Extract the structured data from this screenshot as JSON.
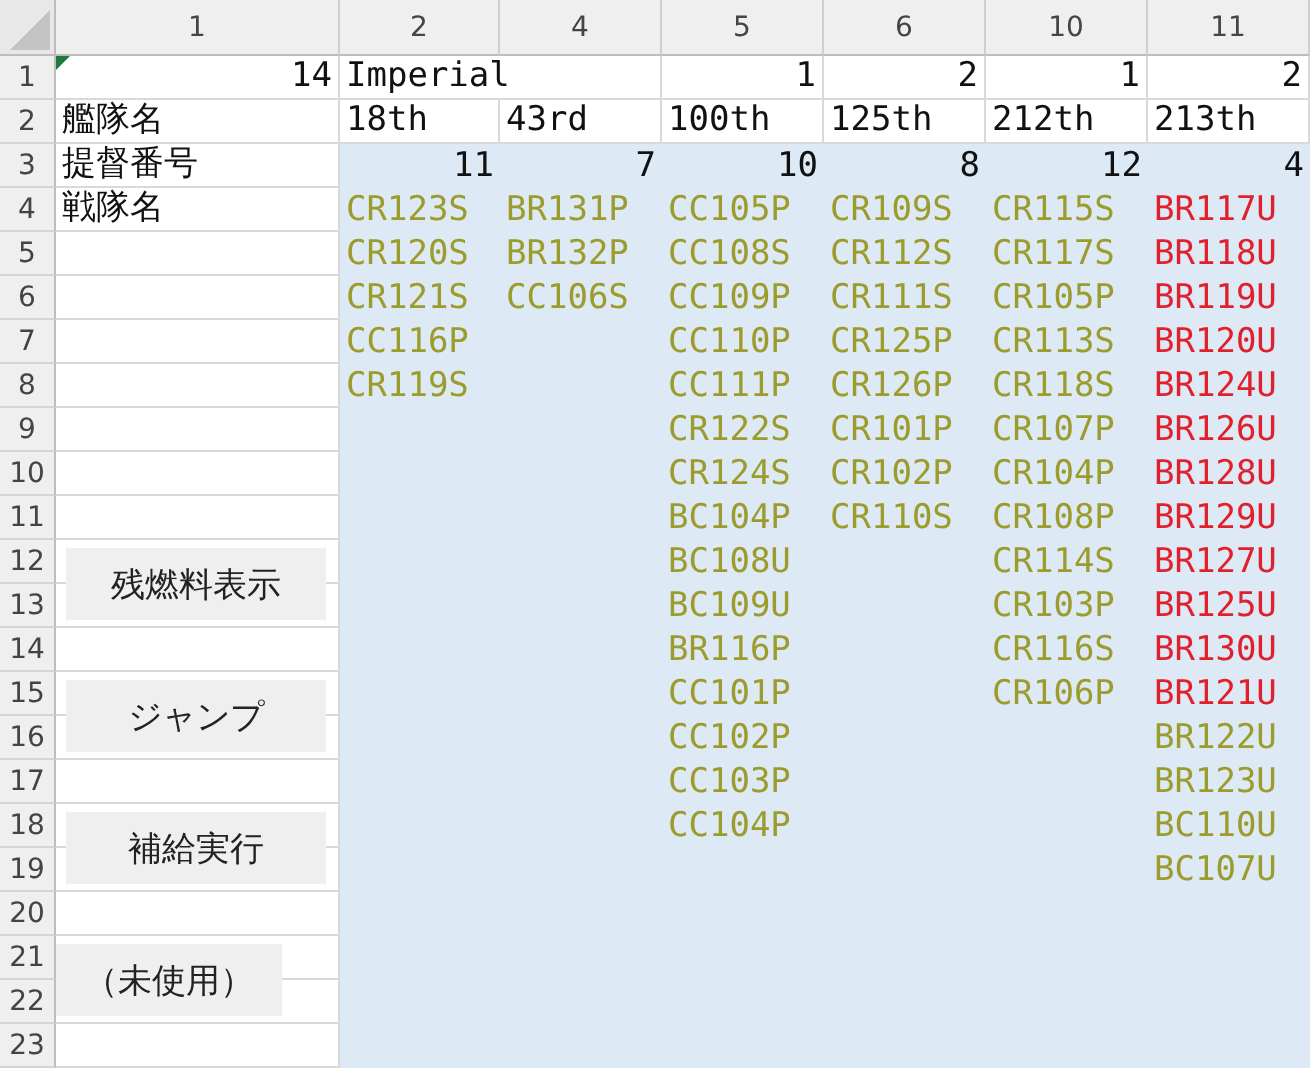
{
  "column_headers": [
    "1",
    "2",
    "4",
    "5",
    "6",
    "10",
    "11"
  ],
  "row_headers": [
    "1",
    "2",
    "3",
    "4",
    "5",
    "6",
    "7",
    "8",
    "9",
    "10",
    "11",
    "12",
    "13",
    "14",
    "15",
    "16",
    "17",
    "18",
    "19",
    "20",
    "21",
    "22",
    "23"
  ],
  "total": "14",
  "faction": "Imperial",
  "labels": [
    "艦隊名",
    "提督番号",
    "戦隊名"
  ],
  "fleets": [
    {
      "name": "18th",
      "admiral": "11",
      "units": [
        {
          "code": "CR123S",
          "color": "#9c9c2c"
        },
        {
          "code": "CR120S",
          "color": "#9c9c2c"
        },
        {
          "code": "CR121S",
          "color": "#9c9c2c"
        },
        {
          "code": "CC116P",
          "color": "#9c9c2c"
        },
        {
          "code": "CR119S",
          "color": "#9c9c2c"
        }
      ]
    },
    {
      "name": "43rd",
      "admiral": "7",
      "units": [
        {
          "code": "BR131P",
          "color": "#9c9c2c"
        },
        {
          "code": "BR132P",
          "color": "#9c9c2c"
        },
        {
          "code": "CC106S",
          "color": "#9c9c2c"
        }
      ]
    },
    {
      "group": "1",
      "name": "100th",
      "admiral": "10",
      "units": [
        {
          "code": "CC105P",
          "color": "#9c9c2c"
        },
        {
          "code": "CC108S",
          "color": "#9c9c2c"
        },
        {
          "code": "CC109P",
          "color": "#9c9c2c"
        },
        {
          "code": "CC110P",
          "color": "#9c9c2c"
        },
        {
          "code": "CC111P",
          "color": "#9c9c2c"
        },
        {
          "code": "CR122S",
          "color": "#9c9c2c"
        },
        {
          "code": "CR124S",
          "color": "#9c9c2c"
        },
        {
          "code": "BC104P",
          "color": "#9c9c2c"
        },
        {
          "code": "BC108U",
          "color": "#9c9c2c"
        },
        {
          "code": "BC109U",
          "color": "#9c9c2c"
        },
        {
          "code": "BR116P",
          "color": "#9c9c2c"
        },
        {
          "code": "CC101P",
          "color": "#9c9c2c"
        },
        {
          "code": "CC102P",
          "color": "#9c9c2c"
        },
        {
          "code": "CC103P",
          "color": "#9c9c2c"
        },
        {
          "code": "CC104P",
          "color": "#9c9c2c"
        }
      ]
    },
    {
      "group": "2",
      "name": "125th",
      "admiral": "8",
      "units": [
        {
          "code": "CR109S",
          "color": "#9c9c2c"
        },
        {
          "code": "CR112S",
          "color": "#9c9c2c"
        },
        {
          "code": "CR111S",
          "color": "#9c9c2c"
        },
        {
          "code": "CR125P",
          "color": "#9c9c2c"
        },
        {
          "code": "CR126P",
          "color": "#9c9c2c"
        },
        {
          "code": "CR101P",
          "color": "#9c9c2c"
        },
        {
          "code": "CR102P",
          "color": "#9c9c2c"
        },
        {
          "code": "CR110S",
          "color": "#9c9c2c"
        }
      ]
    },
    {
      "group": "1",
      "name": "212th",
      "admiral": "12",
      "units": [
        {
          "code": "CR115S",
          "color": "#9c9c2c"
        },
        {
          "code": "CR117S",
          "color": "#9c9c2c"
        },
        {
          "code": "CR105P",
          "color": "#9c9c2c"
        },
        {
          "code": "CR113S",
          "color": "#9c9c2c"
        },
        {
          "code": "CR118S",
          "color": "#9c9c2c"
        },
        {
          "code": "CR107P",
          "color": "#9c9c2c"
        },
        {
          "code": "CR104P",
          "color": "#9c9c2c"
        },
        {
          "code": "CR108P",
          "color": "#9c9c2c"
        },
        {
          "code": "CR114S",
          "color": "#9c9c2c"
        },
        {
          "code": "CR103P",
          "color": "#9c9c2c"
        },
        {
          "code": "CR116S",
          "color": "#9c9c2c"
        },
        {
          "code": "CR106P",
          "color": "#9c9c2c"
        }
      ]
    },
    {
      "group": "2",
      "name": "213th",
      "admiral": "4",
      "units": [
        {
          "code": "BR117U",
          "color": "#e0202c"
        },
        {
          "code": "BR118U",
          "color": "#e0202c"
        },
        {
          "code": "BR119U",
          "color": "#e0202c"
        },
        {
          "code": "BR120U",
          "color": "#e0202c"
        },
        {
          "code": "BR124U",
          "color": "#e0202c"
        },
        {
          "code": "BR126U",
          "color": "#e0202c"
        },
        {
          "code": "BR128U",
          "color": "#e0202c"
        },
        {
          "code": "BR129U",
          "color": "#e0202c"
        },
        {
          "code": "BR127U",
          "color": "#e0202c"
        },
        {
          "code": "BR125U",
          "color": "#e0202c"
        },
        {
          "code": "BR130U",
          "color": "#e0202c"
        },
        {
          "code": "BR121U",
          "color": "#e0202c"
        },
        {
          "code": "BR122U",
          "color": "#9c9c2c"
        },
        {
          "code": "BR123U",
          "color": "#9c9c2c"
        },
        {
          "code": "BC110U",
          "color": "#9c9c2c"
        },
        {
          "code": "BC107U",
          "color": "#9c9c2c"
        }
      ]
    }
  ],
  "buttons": [
    {
      "label": "残燃料表示"
    },
    {
      "label": "ジャンプ"
    },
    {
      "label": "補給実行"
    },
    {
      "label": "（未使用）"
    }
  ]
}
